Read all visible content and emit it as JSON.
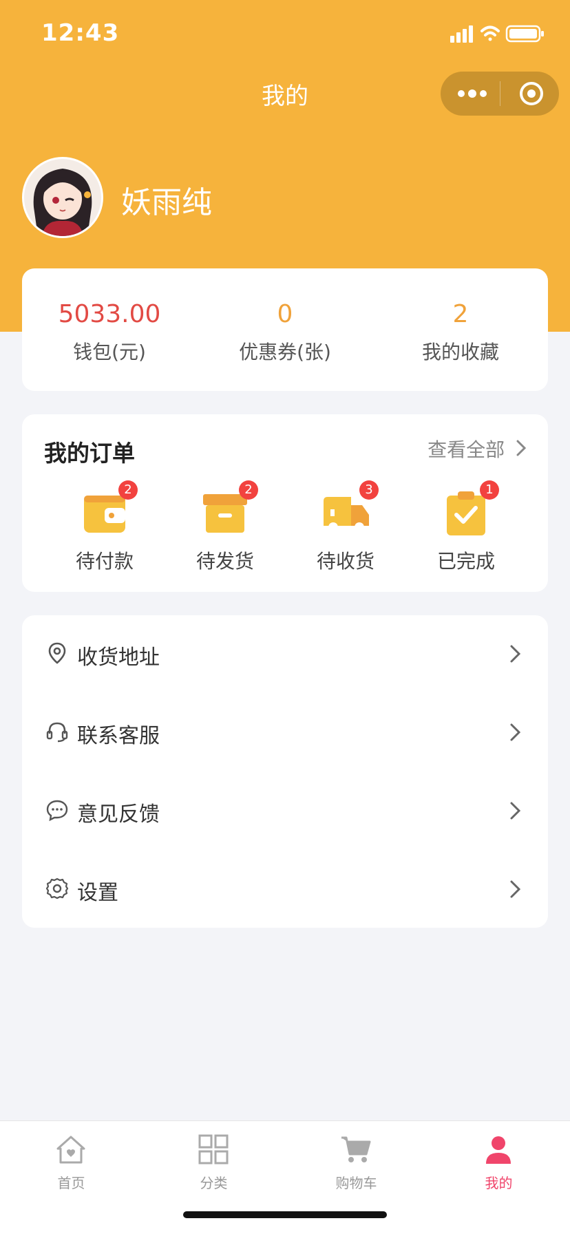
{
  "status_bar": {
    "time": "12:43"
  },
  "nav": {
    "title": "我的"
  },
  "profile": {
    "name": "妖雨纯"
  },
  "stats": [
    {
      "value": "5033.00",
      "label": "钱包(元)",
      "color": "#E24A44"
    },
    {
      "value": "0",
      "label": "优惠券(张)",
      "color": "#F0A23A"
    },
    {
      "value": "2",
      "label": "我的收藏",
      "color": "#F0A23A"
    }
  ],
  "orders": {
    "title": "我的订单",
    "view_all": "查看全部",
    "items": [
      {
        "label": "待付款",
        "badge": "2",
        "icon": "wallet-icon"
      },
      {
        "label": "待发货",
        "badge": "2",
        "icon": "box-icon"
      },
      {
        "label": "待收货",
        "badge": "3",
        "icon": "truck-icon"
      },
      {
        "label": "已完成",
        "badge": "1",
        "icon": "clipboard-check-icon"
      }
    ]
  },
  "menu": [
    {
      "label": "收货地址",
      "icon": "location-pin-icon"
    },
    {
      "label": "联系客服",
      "icon": "headset-icon"
    },
    {
      "label": "意见反馈",
      "icon": "chat-bubble-icon"
    },
    {
      "label": "设置",
      "icon": "gear-icon"
    }
  ],
  "tabbar": [
    {
      "label": "首页",
      "icon": "home-icon",
      "active": false
    },
    {
      "label": "分类",
      "icon": "grid-icon",
      "active": false
    },
    {
      "label": "购物车",
      "icon": "cart-icon",
      "active": false
    },
    {
      "label": "我的",
      "icon": "user-icon",
      "active": true
    }
  ],
  "colors": {
    "header": "#F6B33C",
    "accent_orange": "#F0A23A",
    "wallet_red": "#E24A44",
    "badge_red": "#F2423F",
    "tab_active": "#F0456B"
  }
}
